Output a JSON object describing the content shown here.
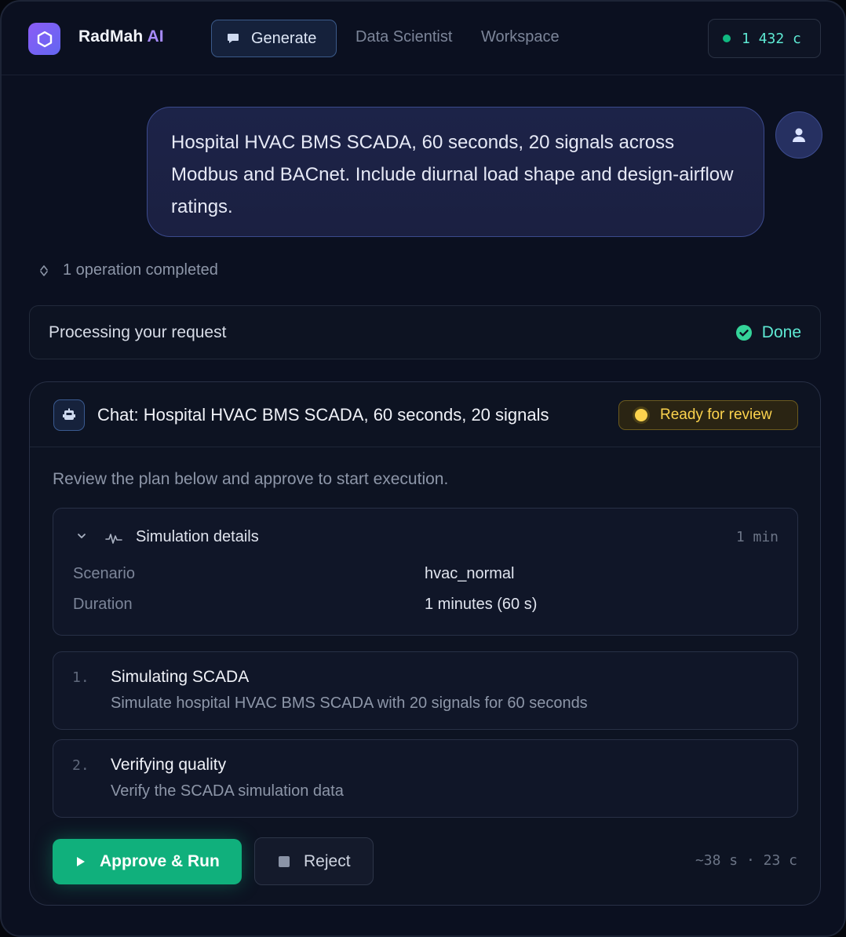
{
  "header": {
    "brand_name": "RadMah",
    "brand_suffix": "AI",
    "nav": {
      "generate": "Generate",
      "data_scientist": "Data Scientist",
      "workspace": "Workspace"
    },
    "credits": "1 432 c"
  },
  "message": {
    "text": "Hospital HVAC BMS SCADA, 60 seconds, 20 signals across Modbus and BACnet. Include diurnal load shape and design-airflow ratings."
  },
  "operations": {
    "label": "1 operation completed"
  },
  "processing": {
    "label": "Processing your request",
    "status": "Done"
  },
  "plan": {
    "title": "Chat: Hospital HVAC BMS SCADA, 60 seconds, 20 signals",
    "badge": "Ready for review",
    "intro": "Review the plan below and approve to start execution.",
    "simulation": {
      "title": "Simulation details",
      "duration_badge": "1 min",
      "rows": [
        {
          "key": "Scenario",
          "value": "hvac_normal"
        },
        {
          "key": "Duration",
          "value": "1 minutes (60 s)"
        }
      ]
    },
    "steps": [
      {
        "num": "1.",
        "title": "Simulating SCADA",
        "desc": "Simulate hospital HVAC BMS SCADA with 20 signals for 60 seconds"
      },
      {
        "num": "2.",
        "title": "Verifying quality",
        "desc": "Verify the SCADA simulation data"
      }
    ],
    "actions": {
      "approve": "Approve & Run",
      "reject": "Reject"
    },
    "estimate": "~38 s · 23 c"
  },
  "colors": {
    "accent_green": "#10b07c",
    "status_teal": "#5eead4",
    "badge_amber": "#fcd34d",
    "brand_purple": "#a78bfa"
  }
}
